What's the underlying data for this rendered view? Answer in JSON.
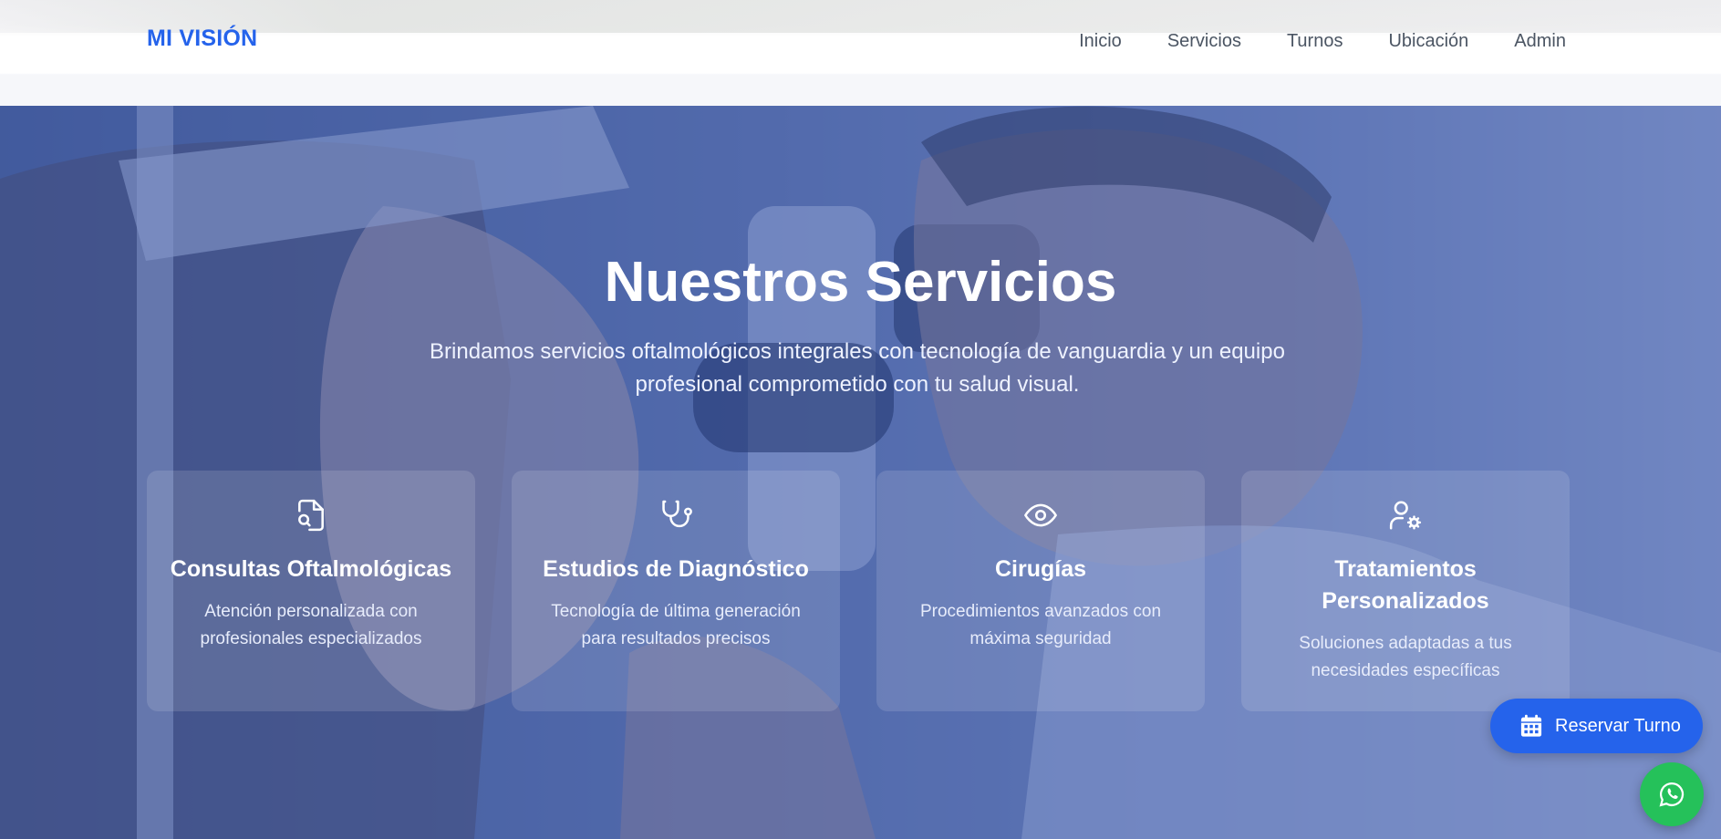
{
  "header": {
    "brand": "MI VISIÓN",
    "nav": [
      "Inicio",
      "Servicios",
      "Turnos",
      "Ubicación",
      "Admin"
    ]
  },
  "hero": {
    "title": "Nuestros Servicios",
    "subtitle": "Brindamos servicios oftalmológicos integrales con tecnología de vanguardia y un equipo profesional comprometido con tu salud visual."
  },
  "services": [
    {
      "icon": "file-search-icon",
      "title": "Consultas Oftalmológicas",
      "description": "Atención personalizada con profesionales especializados"
    },
    {
      "icon": "stethoscope-icon",
      "title": "Estudios de Diagnóstico",
      "description": "Tecnología de última generación para resultados precisos"
    },
    {
      "icon": "eye-icon",
      "title": "Cirugías",
      "description": "Procedimientos avanzados con máxima seguridad"
    },
    {
      "icon": "user-cog-icon",
      "title": "Tratamientos Personalizados",
      "description": "Soluciones adaptadas a tus necesidades específicas"
    }
  ],
  "floating": {
    "reserve_label": "Reservar Turno",
    "whatsapp_icon": "whatsapp-icon"
  },
  "colors": {
    "brand": "#2563eb",
    "overlay": "#2e4eaa",
    "whatsapp": "#25c15a"
  }
}
